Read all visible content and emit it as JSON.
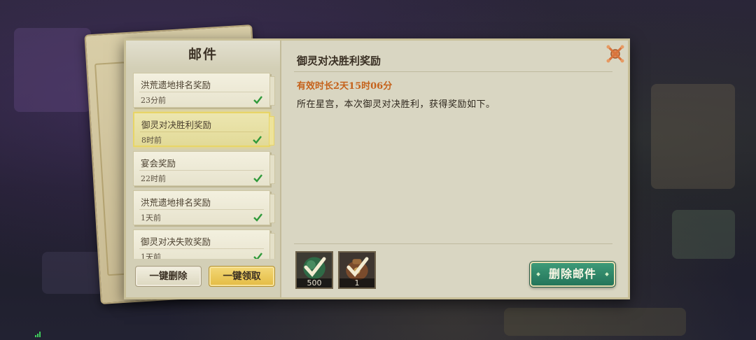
{
  "mail_panel": {
    "title": "邮件",
    "items": [
      {
        "name": "洪荒遗地排名奖励",
        "time": "23分前",
        "claimed": true
      },
      {
        "name": "御灵对决胜利奖励",
        "time": "8时前",
        "claimed": true,
        "selected": true
      },
      {
        "name": "宴会奖励",
        "time": "22时前",
        "claimed": true
      },
      {
        "name": "洪荒遗地排名奖励",
        "time": "1天前",
        "claimed": true
      },
      {
        "name": "御灵对决失败奖励",
        "time": "1天前",
        "claimed": true
      }
    ],
    "delete_all_label": "一键删除",
    "claim_all_label": "一键领取"
  },
  "detail": {
    "title": "御灵对决胜利奖励",
    "validity": "有效时长2天15时06分",
    "body": "所在星宫，本次御灵对决胜利，获得奖励如下。",
    "rewards": [
      {
        "icon": "jade-orb-icon",
        "quantity": "500",
        "claimed": true
      },
      {
        "icon": "treasure-bag-icon",
        "quantity": "1",
        "claimed": true
      }
    ],
    "delete_label": "删除邮件"
  },
  "colors": {
    "accent_orange": "#c5621b",
    "check_green": "#2f9a3a",
    "claim_gold": "#e4bb43",
    "delete_green": "#2a8566"
  }
}
